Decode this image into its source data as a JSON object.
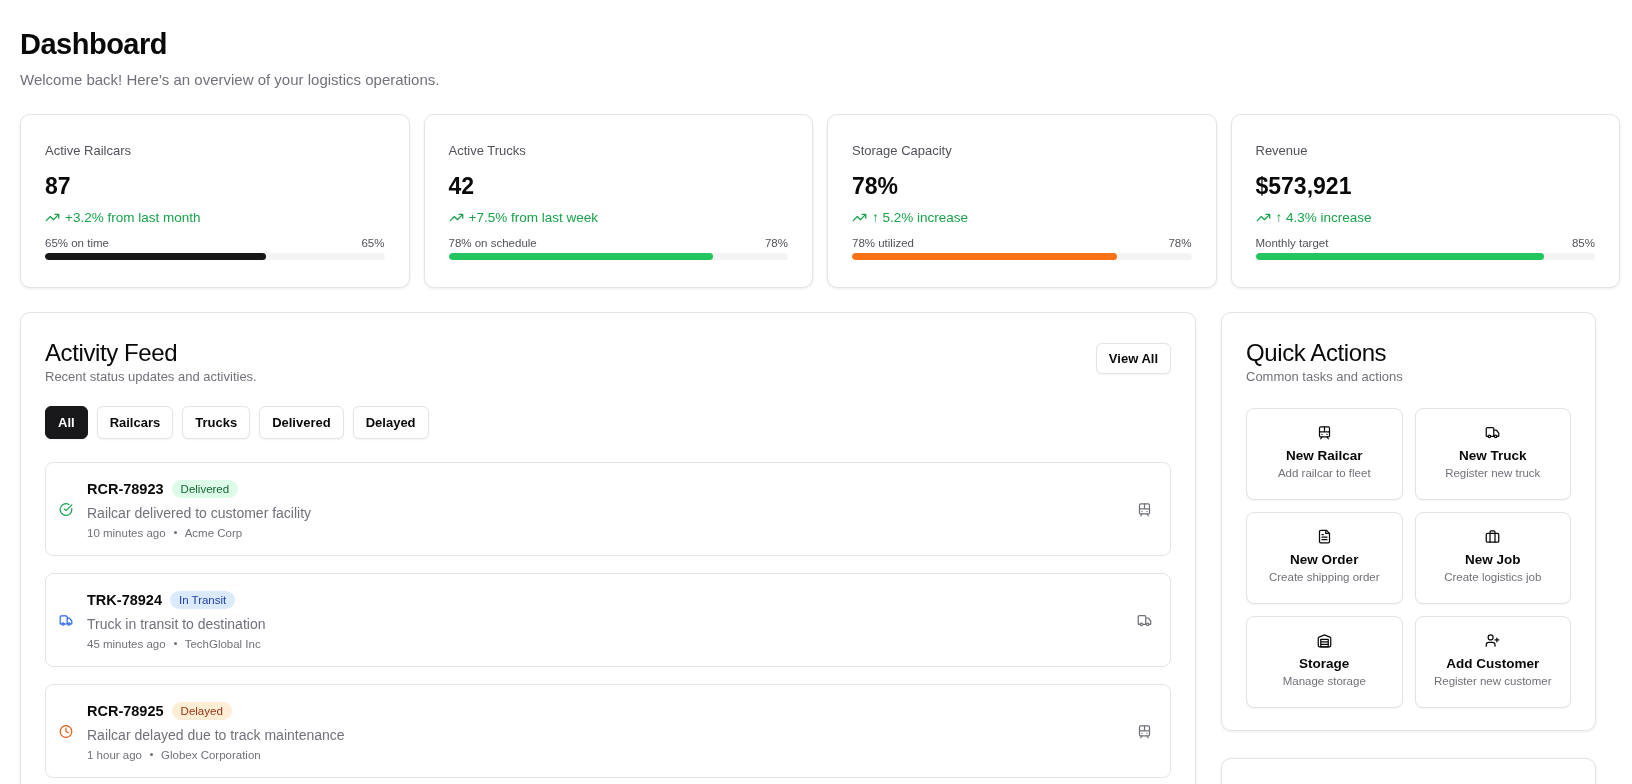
{
  "header": {
    "title": "Dashboard",
    "subtitle": "Welcome back! Here's an overview of your logistics operations."
  },
  "stats": [
    {
      "label": "Active Railcars",
      "value": "87",
      "trend": "+3.2% from last month",
      "bar_label": "65% on time",
      "bar_reading": "65%",
      "level": 0.65,
      "color": "#18181b"
    },
    {
      "label": "Active Trucks",
      "value": "42",
      "trend": "+7.5% from last week",
      "bar_label": "78% on schedule",
      "bar_reading": "78%",
      "level": 0.78,
      "color": "#22c55e"
    },
    {
      "label": "Storage Capacity",
      "value": "78%",
      "trend": "↑ 5.2% increase",
      "bar_label": "78% utilized",
      "bar_reading": "78%",
      "level": 0.78,
      "color": "#f97316"
    },
    {
      "label": "Revenue",
      "value": "$573,921",
      "trend": "↑ 4.3% increase",
      "bar_label": "Monthly target",
      "bar_reading": "85%",
      "level": 0.85,
      "color": "#22c55e"
    }
  ],
  "activity_feed": {
    "title": "Activity Feed",
    "subtitle": "Recent status updates and activities.",
    "view_all": "View All",
    "filters": [
      {
        "label": "All",
        "selected": true
      },
      {
        "label": "Railcars",
        "selected": false
      },
      {
        "label": "Trucks",
        "selected": false
      },
      {
        "label": "Delivered",
        "selected": false
      },
      {
        "label": "Delayed",
        "selected": false
      }
    ],
    "items": [
      {
        "id_label": "RCR-78923",
        "status": "Delivered",
        "kind": "delivered",
        "vehicle_icon": {
          "kind": "railcar"
        },
        "description": "Railcar delivered to customer facility",
        "time": "10 minutes ago",
        "customer": "Acme Corp"
      },
      {
        "id_label": "TRK-78924",
        "status": "In Transit",
        "kind": "transit",
        "vehicle_icon": {
          "kind": "truck"
        },
        "description": "Truck in transit to destination",
        "time": "45 minutes ago",
        "customer": "TechGlobal Inc"
      },
      {
        "id_label": "RCR-78925",
        "status": "Delayed",
        "kind": "delayed",
        "vehicle_icon": {
          "kind": "railcar"
        },
        "description": "Railcar delayed due to track maintenance",
        "time": "1 hour ago",
        "customer": "Globex Corporation"
      }
    ]
  },
  "quick_actions": {
    "title": "Quick Actions",
    "subtitle": "Common tasks and actions",
    "actions": [
      {
        "kind": "railcar",
        "title": "New Railcar",
        "subtitle": "Add railcar to fleet"
      },
      {
        "kind": "truck",
        "title": "New Truck",
        "subtitle": "Register new truck"
      },
      {
        "kind": "order",
        "title": "New Order",
        "subtitle": "Create shipping order"
      },
      {
        "kind": "job",
        "title": "New Job",
        "subtitle": "Create logistics job"
      },
      {
        "kind": "storage",
        "title": "Storage",
        "subtitle": "Manage storage"
      },
      {
        "kind": "customer",
        "title": "Add Customer",
        "subtitle": "Register new customer"
      }
    ]
  }
}
